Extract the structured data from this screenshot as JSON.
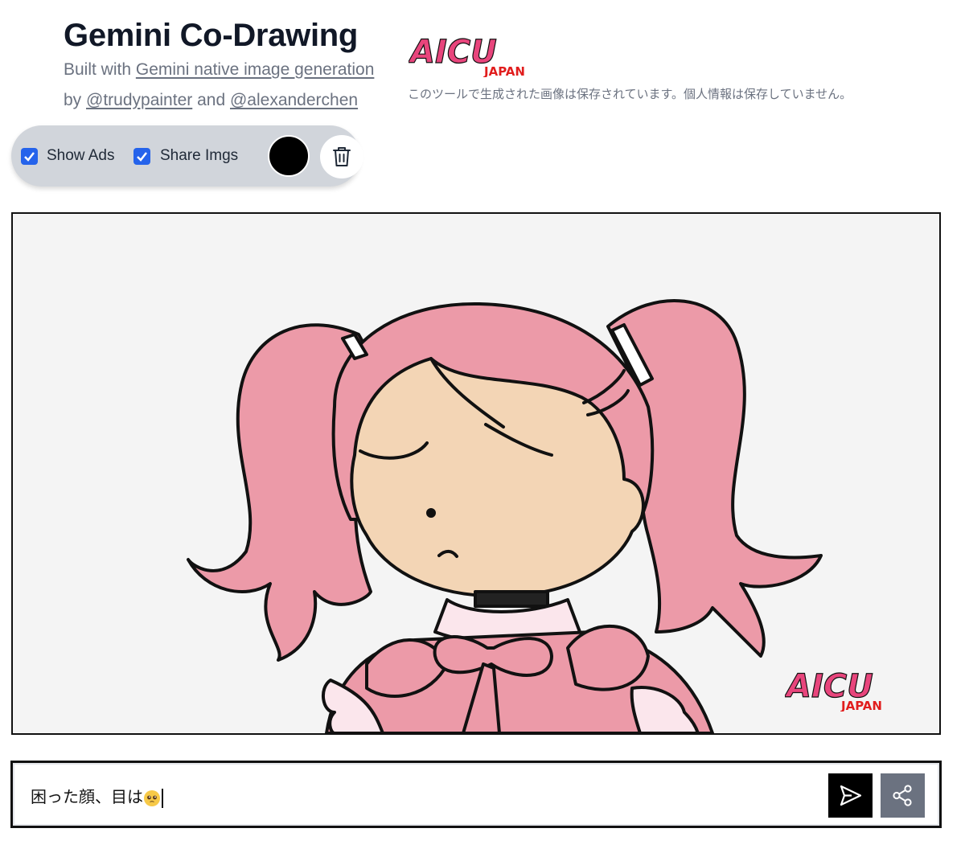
{
  "app": {
    "title": "Gemini Co-Drawing",
    "built_with_prefix": "Built with",
    "built_with_link": "Gemini native image generation",
    "by_prefix": "by",
    "author1": "@trudypainter",
    "and_text": "and",
    "author2": "@alexanderchen"
  },
  "branding": {
    "logo_main": "AICU",
    "logo_sub": "JAPAN",
    "notice": "このツールで生成された画像は保存されています。個人情報は保存していません。"
  },
  "toolbar": {
    "show_ads_label": "Show Ads",
    "show_ads_checked": true,
    "share_imgs_label": "Share Imgs",
    "share_imgs_checked": true,
    "pen_color": "#000000",
    "clear_icon": "trash-icon"
  },
  "canvas": {
    "background": "#f4f4f4",
    "watermark_main": "AICU",
    "watermark_sub": "JAPAN"
  },
  "prompt": {
    "value": "困った顔、目は",
    "emoji": "pleading-face-emoji",
    "send_icon": "send-icon",
    "share_icon": "share-icon"
  },
  "colors": {
    "accent": "#2563eb",
    "logo_pink": "#e8457c",
    "logo_red": "#e11d1d",
    "hair_pink": "#ec9aa8",
    "skin": "#f3d5b5"
  }
}
